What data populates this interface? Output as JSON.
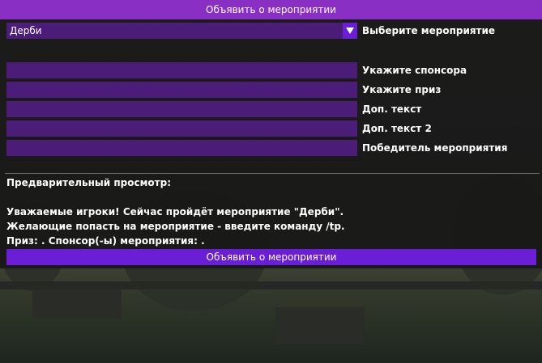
{
  "dialog": {
    "title": "Объявить о мероприятии",
    "event_select": {
      "value": "Дерби",
      "label": "Выберите мероприятие"
    },
    "fields": [
      {
        "label": "Укажите спонсора",
        "value": ""
      },
      {
        "label": "Укажите приз",
        "value": ""
      },
      {
        "label": "Доп. текст",
        "value": ""
      },
      {
        "label": "Доп. текст 2",
        "value": ""
      },
      {
        "label": "Победитель мероприятия",
        "value": ""
      }
    ],
    "preview": {
      "title": "Предварительный просмотр:",
      "line1": "Уважаемые игроки! Сейчас пройдёт мероприятие \"Дерби\".",
      "line2": "Желающие попасть на мероприятие - введите команду /tp.",
      "line3": "Приз: . Спонсор(-ы) мероприятия: ."
    },
    "submit_label": "Объявить о мероприятии"
  },
  "colors": {
    "titlebar": "#8a2fc4",
    "field_bg": "#4b1d78",
    "accent": "#6a1fd6",
    "panel_bg": "#161616"
  }
}
